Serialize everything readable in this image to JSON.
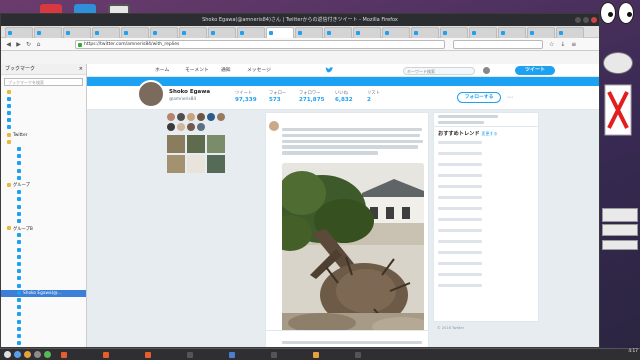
{
  "window": {
    "title": "Shoko Egawa(@amneris84)さん | Twitterからの返信付きツイート - Mozilla Firefox"
  },
  "tabs": [
    "",
    "",
    "",
    "",
    "",
    "",
    "",
    "",
    "",
    "",
    "",
    "",
    "",
    "",
    "",
    "",
    "",
    "",
    "",
    ""
  ],
  "url": "https://twitter.com/amneris84/with_replies",
  "search_placeholder": "",
  "sidebar": {
    "title": "ブックマーク",
    "search_placeholder": "ブックマークを検索",
    "items": [
      {
        "label": "",
        "type": "folder"
      },
      {
        "label": "",
        "type": "link"
      },
      {
        "label": "",
        "type": "link"
      },
      {
        "label": "",
        "type": "link"
      },
      {
        "label": "",
        "type": "link"
      },
      {
        "label": "",
        "type": "link"
      },
      {
        "label": "Twitter",
        "type": "folder"
      },
      {
        "label": "",
        "type": "folder"
      },
      {
        "label": "",
        "type": "link"
      },
      {
        "label": "",
        "type": "link"
      },
      {
        "label": "",
        "type": "link"
      },
      {
        "label": "",
        "type": "link"
      },
      {
        "label": "",
        "type": "link"
      },
      {
        "label": "グループ",
        "type": "folder"
      },
      {
        "label": "",
        "type": "link"
      },
      {
        "label": "",
        "type": "link"
      },
      {
        "label": "",
        "type": "link"
      },
      {
        "label": "",
        "type": "link"
      },
      {
        "label": "",
        "type": "link"
      },
      {
        "label": "グループB",
        "type": "folder"
      },
      {
        "label": "",
        "type": "link"
      },
      {
        "label": "",
        "type": "link"
      },
      {
        "label": "",
        "type": "link"
      },
      {
        "label": "",
        "type": "link"
      },
      {
        "label": "",
        "type": "link"
      },
      {
        "label": "",
        "type": "link"
      },
      {
        "label": "",
        "type": "link"
      },
      {
        "label": "",
        "type": "link"
      },
      {
        "label": "Shoko Egawa(@...",
        "type": "link"
      },
      {
        "label": "",
        "type": "link"
      },
      {
        "label": "",
        "type": "link"
      },
      {
        "label": "",
        "type": "link"
      },
      {
        "label": "",
        "type": "link"
      },
      {
        "label": "",
        "type": "link"
      },
      {
        "label": "",
        "type": "link"
      },
      {
        "label": "",
        "type": "link"
      },
      {
        "label": "",
        "type": "link"
      }
    ]
  },
  "twitter_nav": {
    "home": "ホーム",
    "moments": "モーメント",
    "notifications": "通知",
    "messages": "メッセージ",
    "search_placeholder": "キーワード検索",
    "tweet_button": "ツイート"
  },
  "profile": {
    "name": "Shoko Egawa",
    "handle": "@amneris84",
    "stats": [
      {
        "label": "ツイート",
        "value": "97,339"
      },
      {
        "label": "フォロー",
        "value": "573"
      },
      {
        "label": "フォロワー",
        "value": "271,875"
      },
      {
        "label": "いいね",
        "value": "6,832"
      },
      {
        "label": "リスト",
        "value": "2"
      }
    ],
    "follow_button": "フォローする",
    "more_icon": "⋯"
  },
  "left_column": {
    "followers_link": "",
    "photos_link": ""
  },
  "tweet": {
    "retweet_note": "",
    "author": "",
    "second_author": "",
    "second_logo": ""
  },
  "trends": {
    "title": "おすすめトレンド",
    "change": "変更する",
    "items": [
      "",
      "",
      "",
      "",
      "",
      "",
      "",
      "",
      "",
      "",
      "",
      "",
      "",
      ""
    ]
  },
  "footer": "© 2018 Twitter",
  "taskbar": {
    "items": [
      "",
      "",
      "",
      "",
      "",
      "",
      "",
      ""
    ],
    "clock_time": "4:17",
    "clock_date": ""
  },
  "desktop_notes": [
    "",
    "",
    ""
  ]
}
